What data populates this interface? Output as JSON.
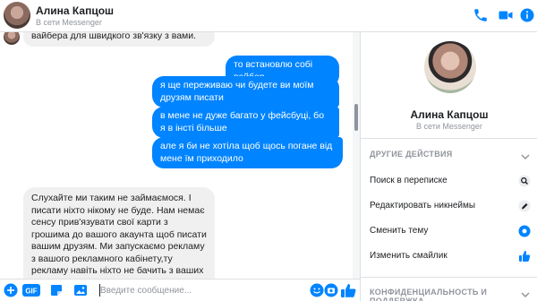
{
  "header": {
    "name": "Алина Капцош",
    "status": "В сети Messenger",
    "accent": "#0084ff"
  },
  "messages": [
    {
      "dir": "in",
      "text": "вайбера для швидкого зв'язку з вами."
    },
    {
      "dir": "out",
      "text": "то встановлю собі вайбер"
    },
    {
      "dir": "out",
      "text": "я ще переживаю чи будете ви моїм друзям писати"
    },
    {
      "dir": "out",
      "text": "в мене не дуже багато у фейсбуці, бо я в інсті більше"
    },
    {
      "dir": "out",
      "text": "але я би не хотіла щоб щось погане від мене їм приходило"
    },
    {
      "dir": "in",
      "text": "Слухайте ми таким не займаємося. І писати ніхто нікому не буде. Нам немає сенсу прив'язувати свої карти з грошима до вашого акаунта щоб писати вашим друзям. Ми запускаємо рекламу з вашого рекламного кабінету,ту рекламу навіть ніхто не бачить з ваших друзів не те,щоб ми"
    }
  ],
  "composer": {
    "placeholder": "Введите сообщение...",
    "gif_label": "GIF"
  },
  "panel": {
    "name": "Алина Капцош",
    "status": "В сети Messenger",
    "other_actions_title": "ДРУГИЕ ДЕЙСТВИЯ",
    "actions": [
      {
        "label": "Поиск в переписке",
        "icon": "search-icon"
      },
      {
        "label": "Редактировать никнеймы",
        "icon": "pencil-icon"
      },
      {
        "label": "Сменить тему",
        "icon": "theme-icon"
      },
      {
        "label": "Изменить смайлик",
        "icon": "thumbs-up-icon"
      }
    ],
    "privacy_title": "КОНФИДЕНЦИАЛЬНОСТЬ И ПОДДЕРЖКА"
  }
}
